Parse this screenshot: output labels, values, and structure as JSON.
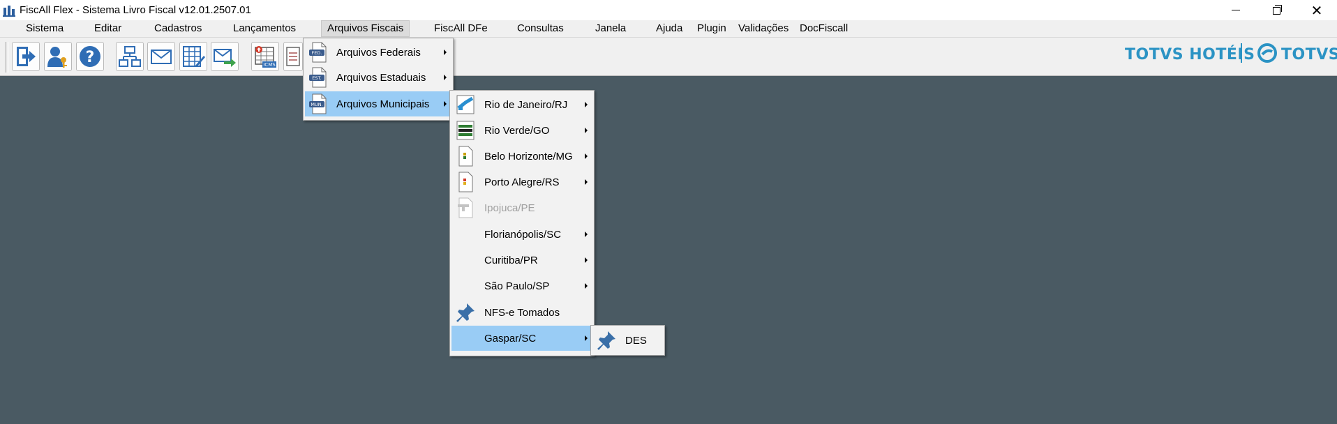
{
  "window": {
    "title": "FiscAll Flex - Sistema Livro Fiscal v12.01.2507.01",
    "close_glyph": "✕"
  },
  "menubar": [
    "Sistema",
    "Editar",
    "Cadastros",
    "Lançamentos",
    "Arquivos Fiscais",
    "FiscAll DFe",
    "Consultas",
    "Janela",
    "Ajuda",
    "Plugin",
    "Validações",
    "DocFiscall"
  ],
  "toolbar": {
    "icons": [
      "exit-icon",
      "user-key-icon",
      "help-icon",
      "hierarchy-icon",
      "envelope-icon",
      "spreadsheet-edit-icon",
      "send-mail-icon",
      "icms-table-icon",
      "document-icon"
    ]
  },
  "brand": {
    "hotel": "TOTVS HOTÉIS",
    "totvs": "TOTVS",
    "color": "#2b93c4"
  },
  "menu_fiscais": {
    "items": [
      {
        "label": "Arquivos Federais",
        "badge": "FED."
      },
      {
        "label": "Arquivos Estaduais",
        "badge": "EST."
      },
      {
        "label": "Arquivos Municipais",
        "badge": "MUN."
      }
    ]
  },
  "menu_municipais": {
    "items": [
      {
        "label": "Rio de Janeiro/RJ"
      },
      {
        "label": "Rio Verde/GO"
      },
      {
        "label": "Belo Horizonte/MG"
      },
      {
        "label": "Porto Alegre/RS"
      },
      {
        "label": "Ipojuca/PE"
      },
      {
        "label": "Florianópolis/SC"
      },
      {
        "label": "Curitiba/PR"
      },
      {
        "label": "São Paulo/SP"
      },
      {
        "label": "NFS-e Tomados"
      },
      {
        "label": "Gaspar/SC"
      }
    ]
  },
  "menu_gaspar": {
    "items": [
      {
        "label": "DES"
      }
    ]
  },
  "colors": {
    "workspace": "#4a5a63",
    "highlight": "#99ccf5",
    "menu_bg": "#f2f2f2"
  }
}
